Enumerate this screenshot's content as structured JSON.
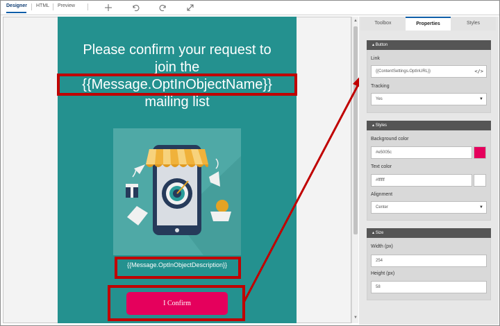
{
  "toolbar": {
    "tabs": [
      {
        "label": "Designer",
        "active": true
      },
      {
        "label": "HTML",
        "active": false
      },
      {
        "label": "Preview",
        "active": false
      }
    ],
    "icons": [
      "add-icon",
      "undo-icon",
      "redo-icon",
      "fullscreen-icon"
    ]
  },
  "email": {
    "headline_lines": [
      "Please confirm your request to",
      "join the",
      "{{Message.OptInObjectName}}",
      "mailing list"
    ],
    "description": "{{Message.OptInObjectDescription}}",
    "button_label": "I Confirm",
    "background": "#24918f",
    "button_color": "#e5005c"
  },
  "panel": {
    "tabs": [
      {
        "label": "Toolbox",
        "active": false
      },
      {
        "label": "Properties",
        "active": true
      },
      {
        "label": "Styles",
        "active": false
      }
    ],
    "button_section": {
      "title": "Button",
      "link_label": "Link",
      "link_value": "{{ContentSettings.OptInURL}}",
      "tracking_label": "Tracking",
      "tracking_value": "Yes"
    },
    "styles_section": {
      "title": "Styles",
      "bg_label": "Background color",
      "bg_value": "#e5005c",
      "text_label": "Text color",
      "text_value": "#ffffff",
      "align_label": "Alignment",
      "align_value": "Center"
    },
    "size_section": {
      "title": "Size",
      "width_label": "Width (px)",
      "width_value": "254",
      "height_label": "Height (px)",
      "height_value": "58"
    }
  },
  "highlight_color": "#c00000"
}
